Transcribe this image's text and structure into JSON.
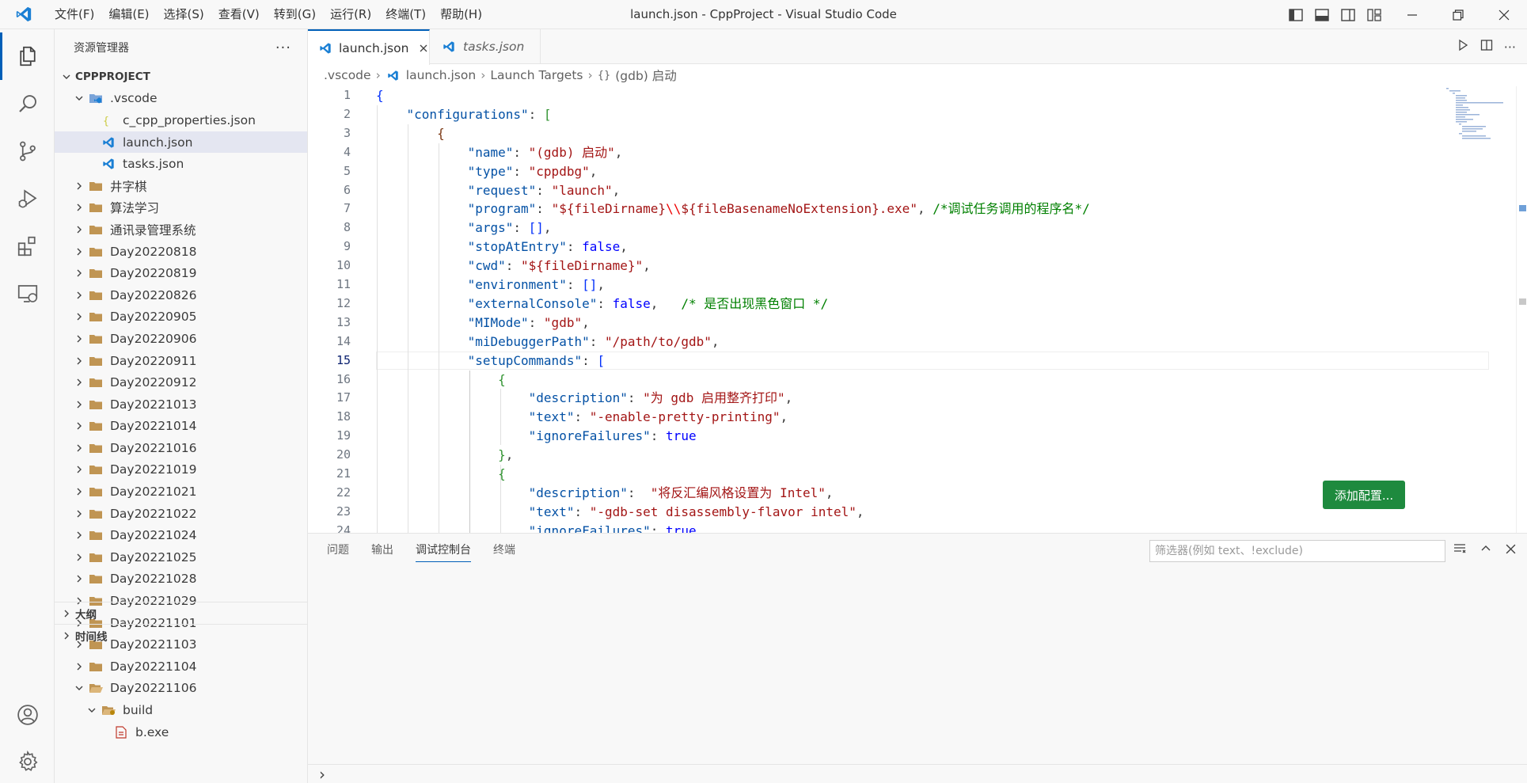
{
  "window": {
    "title": "launch.json - CppProject - Visual Studio Code",
    "menu": [
      "文件(F)",
      "编辑(E)",
      "选择(S)",
      "查看(V)",
      "转到(G)",
      "运行(R)",
      "终端(T)",
      "帮助(H)"
    ]
  },
  "sidebar": {
    "title": "资源管理器",
    "more": "···",
    "root": "CPPPROJECT",
    "tree": [
      {
        "label": ".vscode",
        "kind": "vscode-folder",
        "depth": 1,
        "expanded": true
      },
      {
        "label": "c_cpp_properties.json",
        "kind": "json",
        "depth": 2
      },
      {
        "label": "launch.json",
        "kind": "vscode-json",
        "depth": 2,
        "selected": true
      },
      {
        "label": "tasks.json",
        "kind": "vscode-json",
        "depth": 2
      },
      {
        "label": "井字棋",
        "kind": "folder",
        "depth": 1
      },
      {
        "label": "算法学习",
        "kind": "folder",
        "depth": 1
      },
      {
        "label": "通讯录管理系统",
        "kind": "folder",
        "depth": 1
      },
      {
        "label": "Day20220818",
        "kind": "folder",
        "depth": 1
      },
      {
        "label": "Day20220819",
        "kind": "folder",
        "depth": 1
      },
      {
        "label": "Day20220826",
        "kind": "folder",
        "depth": 1
      },
      {
        "label": "Day20220905",
        "kind": "folder",
        "depth": 1
      },
      {
        "label": "Day20220906",
        "kind": "folder",
        "depth": 1
      },
      {
        "label": "Day20220911",
        "kind": "folder",
        "depth": 1
      },
      {
        "label": "Day20220912",
        "kind": "folder",
        "depth": 1
      },
      {
        "label": "Day20221013",
        "kind": "folder",
        "depth": 1
      },
      {
        "label": "Day20221014",
        "kind": "folder",
        "depth": 1
      },
      {
        "label": "Day20221016",
        "kind": "folder",
        "depth": 1
      },
      {
        "label": "Day20221019",
        "kind": "folder",
        "depth": 1
      },
      {
        "label": "Day20221021",
        "kind": "folder",
        "depth": 1
      },
      {
        "label": "Day20221022",
        "kind": "folder",
        "depth": 1
      },
      {
        "label": "Day20221024",
        "kind": "folder",
        "depth": 1
      },
      {
        "label": "Day20221025",
        "kind": "folder",
        "depth": 1
      },
      {
        "label": "Day20221028",
        "kind": "folder",
        "depth": 1
      },
      {
        "label": "Day20221029",
        "kind": "folder",
        "depth": 1
      },
      {
        "label": "Day20221101",
        "kind": "folder",
        "depth": 1
      },
      {
        "label": "Day20221103",
        "kind": "folder",
        "depth": 1
      },
      {
        "label": "Day20221104",
        "kind": "folder",
        "depth": 1
      },
      {
        "label": "Day20221106",
        "kind": "open-folder",
        "depth": 1,
        "expanded": true
      },
      {
        "label": "build",
        "kind": "build-folder",
        "depth": 2,
        "expanded": true
      },
      {
        "label": "b.exe",
        "kind": "exe",
        "depth": 3
      }
    ],
    "outline": "大纲",
    "timeline": "时间线"
  },
  "tabs": [
    {
      "label": "launch.json",
      "active": true
    },
    {
      "label": "tasks.json",
      "active": false,
      "italic": true
    }
  ],
  "breadcrumb": [
    ".vscode",
    "launch.json",
    "Launch Targets",
    "(gdb) 启动"
  ],
  "editor": {
    "current_line": 15,
    "lines": [
      [
        [
          "b1",
          "{"
        ]
      ],
      [
        [
          "t",
          "    "
        ],
        [
          "k",
          "\"configurations\""
        ],
        [
          "t",
          ": "
        ],
        [
          "b2",
          "["
        ]
      ],
      [
        [
          "t",
          "        "
        ],
        [
          "b3",
          "{"
        ]
      ],
      [
        [
          "t",
          "            "
        ],
        [
          "k",
          "\"name\""
        ],
        [
          "t",
          ": "
        ],
        [
          "s",
          "\"(gdb) 启动\""
        ],
        [
          "t",
          ","
        ]
      ],
      [
        [
          "t",
          "            "
        ],
        [
          "k",
          "\"type\""
        ],
        [
          "t",
          ": "
        ],
        [
          "s",
          "\"cppdbg\""
        ],
        [
          "t",
          ","
        ]
      ],
      [
        [
          "t",
          "            "
        ],
        [
          "k",
          "\"request\""
        ],
        [
          "t",
          ": "
        ],
        [
          "s",
          "\"launch\""
        ],
        [
          "t",
          ","
        ]
      ],
      [
        [
          "t",
          "            "
        ],
        [
          "k",
          "\"program\""
        ],
        [
          "t",
          ": "
        ],
        [
          "s",
          "\"${fileDirname}"
        ],
        [
          "esc",
          "\\\\"
        ],
        [
          "s",
          "${fileBasenameNoExtension}.exe\""
        ],
        [
          "t",
          ", "
        ],
        [
          "c",
          "/*调试任务调用的程序名*/"
        ]
      ],
      [
        [
          "t",
          "            "
        ],
        [
          "k",
          "\"args\""
        ],
        [
          "t",
          ": "
        ],
        [
          "b1",
          "[]"
        ],
        [
          "t",
          ","
        ]
      ],
      [
        [
          "t",
          "            "
        ],
        [
          "k",
          "\"stopAtEntry\""
        ],
        [
          "t",
          ": "
        ],
        [
          "kw",
          "false"
        ],
        [
          "t",
          ","
        ]
      ],
      [
        [
          "t",
          "            "
        ],
        [
          "k",
          "\"cwd\""
        ],
        [
          "t",
          ": "
        ],
        [
          "s",
          "\"${fileDirname}\""
        ],
        [
          "t",
          ","
        ]
      ],
      [
        [
          "t",
          "            "
        ],
        [
          "k",
          "\"environment\""
        ],
        [
          "t",
          ": "
        ],
        [
          "b1",
          "[]"
        ],
        [
          "t",
          ","
        ]
      ],
      [
        [
          "t",
          "            "
        ],
        [
          "k",
          "\"externalConsole\""
        ],
        [
          "t",
          ": "
        ],
        [
          "kw",
          "false"
        ],
        [
          "t",
          ",   "
        ],
        [
          "c",
          "/* 是否出现黑色窗口 */"
        ]
      ],
      [
        [
          "t",
          "            "
        ],
        [
          "k",
          "\"MIMode\""
        ],
        [
          "t",
          ": "
        ],
        [
          "s",
          "\"gdb\""
        ],
        [
          "t",
          ","
        ]
      ],
      [
        [
          "t",
          "            "
        ],
        [
          "k",
          "\"miDebuggerPath\""
        ],
        [
          "t",
          ": "
        ],
        [
          "s",
          "\"/path/to/gdb\""
        ],
        [
          "t",
          ","
        ]
      ],
      [
        [
          "t",
          "            "
        ],
        [
          "k",
          "\"setupCommands\""
        ],
        [
          "t",
          ": "
        ],
        [
          "b1",
          "["
        ]
      ],
      [
        [
          "t",
          "                "
        ],
        [
          "b2",
          "{"
        ]
      ],
      [
        [
          "t",
          "                    "
        ],
        [
          "k",
          "\"description\""
        ],
        [
          "t",
          ": "
        ],
        [
          "s",
          "\"为 gdb 启用整齐打印\""
        ],
        [
          "t",
          ","
        ]
      ],
      [
        [
          "t",
          "                    "
        ],
        [
          "k",
          "\"text\""
        ],
        [
          "t",
          ": "
        ],
        [
          "s",
          "\"-enable-pretty-printing\""
        ],
        [
          "t",
          ","
        ]
      ],
      [
        [
          "t",
          "                    "
        ],
        [
          "k",
          "\"ignoreFailures\""
        ],
        [
          "t",
          ": "
        ],
        [
          "kw",
          "true"
        ]
      ],
      [
        [
          "t",
          "                "
        ],
        [
          "b2",
          "}"
        ],
        [
          "t",
          ","
        ]
      ],
      [
        [
          "t",
          "                "
        ],
        [
          "b2",
          "{"
        ]
      ],
      [
        [
          "t",
          "                    "
        ],
        [
          "k",
          "\"description\""
        ],
        [
          "t",
          ":  "
        ],
        [
          "s",
          "\"将反汇编风格设置为 Intel\""
        ],
        [
          "t",
          ","
        ]
      ],
      [
        [
          "t",
          "                    "
        ],
        [
          "k",
          "\"text\""
        ],
        [
          "t",
          ": "
        ],
        [
          "s",
          "\"-gdb-set disassembly-flavor intel\""
        ],
        [
          "t",
          ","
        ]
      ],
      [
        [
          "t",
          "                    "
        ],
        [
          "k",
          "\"ignoreFailures\""
        ],
        [
          "t",
          ": "
        ],
        [
          "kw",
          "true"
        ]
      ]
    ],
    "add_config_label": "添加配置..."
  },
  "panel": {
    "tabs": [
      "问题",
      "输出",
      "调试控制台",
      "终端"
    ],
    "active_tab": 2,
    "filter_placeholder": "筛选器(例如 text、!exclude)",
    "prompt": "›"
  },
  "colors": {
    "accent": "#005fb8",
    "button": "#1e8a3e",
    "vscode_blue": "#1a7fd4"
  }
}
